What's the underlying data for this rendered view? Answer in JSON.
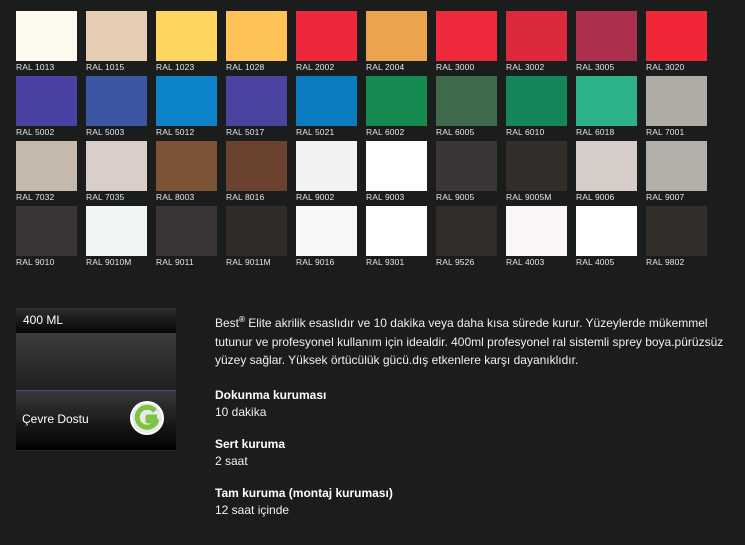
{
  "swatches": [
    {
      "code": "RAL 1013",
      "color": "#fdf9ee"
    },
    {
      "code": "RAL 1015",
      "color": "#e6ceb4"
    },
    {
      "code": "RAL 1023",
      "color": "#fed55e"
    },
    {
      "code": "RAL 1028",
      "color": "#fdc356"
    },
    {
      "code": "RAL 2002",
      "color": "#ee273d"
    },
    {
      "code": "RAL 2004",
      "color": "#eca34e"
    },
    {
      "code": "RAL 3000",
      "color": "#ee2a3c"
    },
    {
      "code": "RAL 3002",
      "color": "#dc2a3c"
    },
    {
      "code": "RAL 3005",
      "color": "#ac2f4d"
    },
    {
      "code": "RAL 3020",
      "color": "#ef2736"
    },
    {
      "code": "RAL 5002",
      "color": "#4a42a3"
    },
    {
      "code": "RAL 5003",
      "color": "#3d56a4"
    },
    {
      "code": "RAL 5012",
      "color": "#0d84c9"
    },
    {
      "code": "RAL 5017",
      "color": "#4a43a0"
    },
    {
      "code": "RAL 5021",
      "color": "#0b7cc2"
    },
    {
      "code": "RAL 6002",
      "color": "#158a50"
    },
    {
      "code": "RAL 6005",
      "color": "#3f6b4c"
    },
    {
      "code": "RAL 6010",
      "color": "#138759"
    },
    {
      "code": "RAL 6018",
      "color": "#2db189"
    },
    {
      "code": "RAL 7001",
      "color": "#aeaca5"
    },
    {
      "code": "RAL 7032",
      "color": "#c5b8ad"
    },
    {
      "code": "RAL 7035",
      "color": "#d9cfc8"
    },
    {
      "code": "RAL 8003",
      "color": "#7c5435"
    },
    {
      "code": "RAL 8016",
      "color": "#6b4230"
    },
    {
      "code": "RAL 9002",
      "color": "#f1f3f0"
    },
    {
      "code": "RAL 9003",
      "color": "#ffffff"
    },
    {
      "code": "RAL 9005",
      "color": "#3a3636"
    },
    {
      "code": "RAL 9005M",
      "color": "#332e29"
    },
    {
      "code": "RAL 9006",
      "color": "#d6cdc9"
    },
    {
      "code": "RAL 9007",
      "color": "#b3b0aa"
    },
    {
      "code": "RAL 9010",
      "color": "#3a3636"
    },
    {
      "code": "RAL 9010M",
      "color": "#f1f5f4"
    },
    {
      "code": "RAL 9011",
      "color": "#3a3535"
    },
    {
      "code": "RAL 9011M",
      "color": "#302c27"
    },
    {
      "code": "RAL 9016",
      "color": "#f7f7f8"
    },
    {
      "code": "RAL 9301",
      "color": "#ffffff"
    },
    {
      "code": "RAL 9526",
      "color": "#312e29"
    },
    {
      "code": "RAL 4003",
      "color": "#faf6f8"
    },
    {
      "code": "RAL 4005",
      "color": "#ffffff"
    },
    {
      "code": "RAL 9802",
      "color": "#322e2a"
    }
  ],
  "sidebar": {
    "volume": "400 ML",
    "eco_label": "Çevre Dostu",
    "eco_icon": "eco-g-badge-icon"
  },
  "product": {
    "brand": "Best",
    "brand_mark": "®",
    "description": " Elite akrilik esaslıdır ve 10 dakika veya daha kısa sürede kurur. Yüzeylerde mükemmel tutunur ve profesyonel kullanım için idealdir. 400ml profesyonel ral sistemli sprey boya.pürüzsüz yüzey sağlar. Yüksek örtücülük gücü.dış etkenlere karşı dayanıklıdır.",
    "specs": [
      {
        "label": "Dokunma kuruması",
        "value": "10 dakika"
      },
      {
        "label": "Sert kuruma",
        "value": "2 saat"
      },
      {
        "label": "Tam kuruma (montaj kuruması)",
        "value": "12 saat içinde"
      }
    ]
  },
  "colors": {
    "background": "#1b1c1c",
    "eco_green": "#7cc243"
  }
}
